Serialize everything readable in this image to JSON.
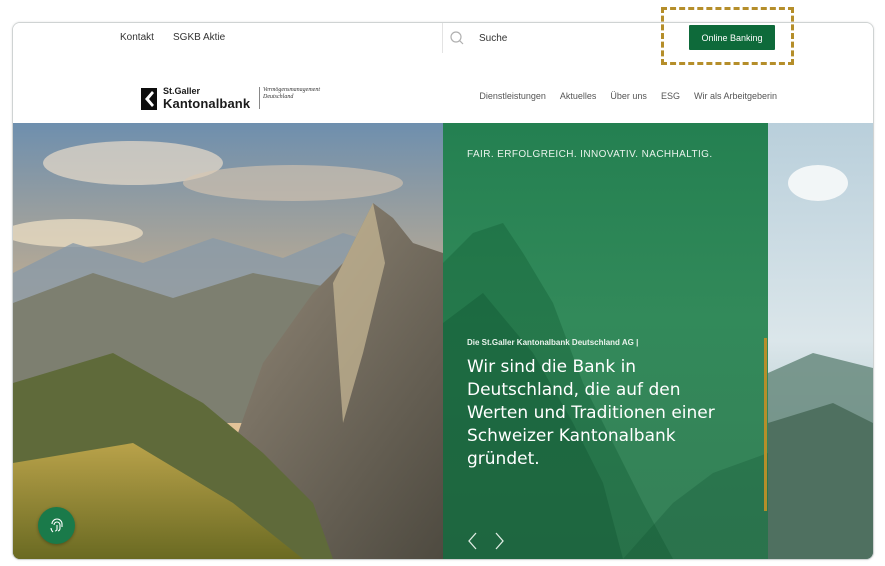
{
  "topbar": {
    "links": [
      "Kontakt",
      "SGKB Aktie"
    ],
    "search": {
      "placeholder": "Suche"
    },
    "online_banking_label": "Online Banking"
  },
  "header": {
    "logo": {
      "line1": "St.Galler",
      "line2": "Kantonalbank",
      "sub1": "Vermögensmanagement",
      "sub2": "Deutschland"
    },
    "nav": [
      "Dienstleistungen",
      "Aktuelles",
      "Über uns",
      "ESG",
      "Wir als Arbeitgeberin"
    ]
  },
  "hero": {
    "tagline": "FAIR. ERFOLGREICH. INNOVATIV. NACHHALTIG.",
    "kicker": "Die St.Galler Kantonalbank Deutschland AG |",
    "headline": "Wir sind die Bank in Deutschland, die auf den Werten und Traditionen einer Schweizer Kantonalbank gründet."
  },
  "icons": {
    "search": "search-icon",
    "prev": "chevron-left-icon",
    "next": "chevron-right-icon",
    "fingerprint": "fingerprint-icon"
  },
  "colors": {
    "brand_green": "#0e6a3a",
    "panel_green": "#17784a",
    "accent_gold": "#b58e2a"
  }
}
